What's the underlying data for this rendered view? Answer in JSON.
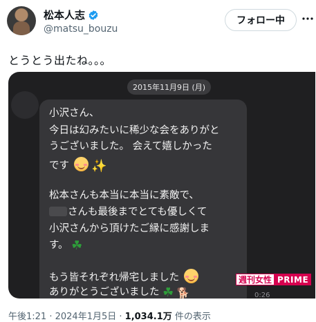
{
  "author": {
    "display_name": "松本人志",
    "handle": "@matsu_bouzu"
  },
  "follow_button": "フォロー中",
  "tweet_text": "とうとう出たね。。。",
  "image": {
    "date": "2015年11月9日 (月)",
    "lines": {
      "l1": "小沢さん、",
      "l2": "今日は幻みたいに稀少な会をありがと",
      "l3": "うございました。 会えて嬉しかった",
      "l4": "です",
      "l5": "松本さんも本当に本当に素敵で、",
      "l6": "さんも最後までとても優しくて",
      "l7": "小沢さんから頂けたご縁に感謝しま",
      "l8": "す。",
      "l9": "もう皆それぞれ帰宅しました",
      "l10": "ありがとうございました"
    },
    "timestamp": "0:26",
    "watermark_left": "週刊女性",
    "watermark_right": "PRIME"
  },
  "meta": {
    "time": "午後1:21",
    "sep1": " · ",
    "date": "2024年1月5日",
    "sep2": " · ",
    "views": "1,034.1万",
    "views_label": " 件の表示"
  },
  "icons": {
    "verified": "verified-badge-icon",
    "more": "more-dots-icon",
    "sparkle": "sparkles-emoji",
    "clover": "four-leaf-clover-emoji",
    "dog": "dog-emoji",
    "smile": "smiling-face-emoji"
  },
  "colors": {
    "verified_blue": "#1d9bf0",
    "watermark_pink": "#d6004f",
    "secondary_text": "#536471"
  }
}
